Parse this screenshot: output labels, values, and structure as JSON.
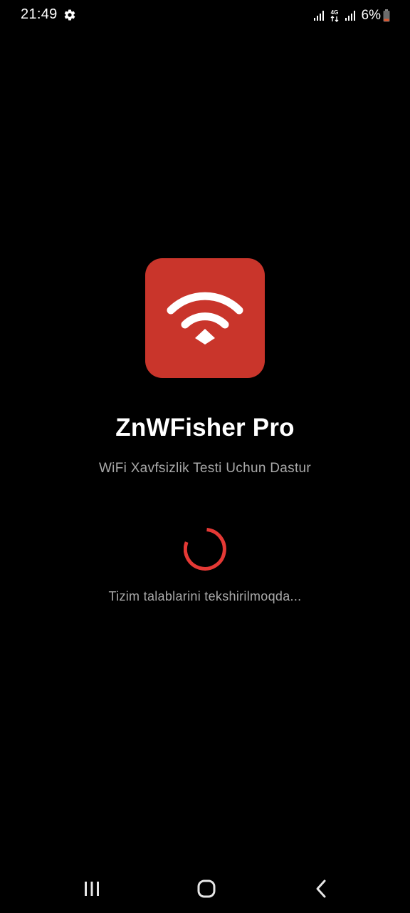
{
  "status_bar": {
    "time": "21:49",
    "settings_icon": "gear-icon",
    "network_type": "4G",
    "battery_percent": "6%",
    "battery_color": "#e4572e"
  },
  "app": {
    "logo_icon": "wifi-icon",
    "logo_color": "#c9352b",
    "title": "ZnWFisher Pro",
    "subtitle": "WiFi Xavfsizlik Testi Uchun Dastur"
  },
  "loading": {
    "spinner_color": "#e53935",
    "message": "Tizim talablarini tekshirilmoqda..."
  },
  "nav_bar": {
    "recents_icon": "recents-icon",
    "home_icon": "home-icon",
    "back_icon": "back-icon"
  }
}
